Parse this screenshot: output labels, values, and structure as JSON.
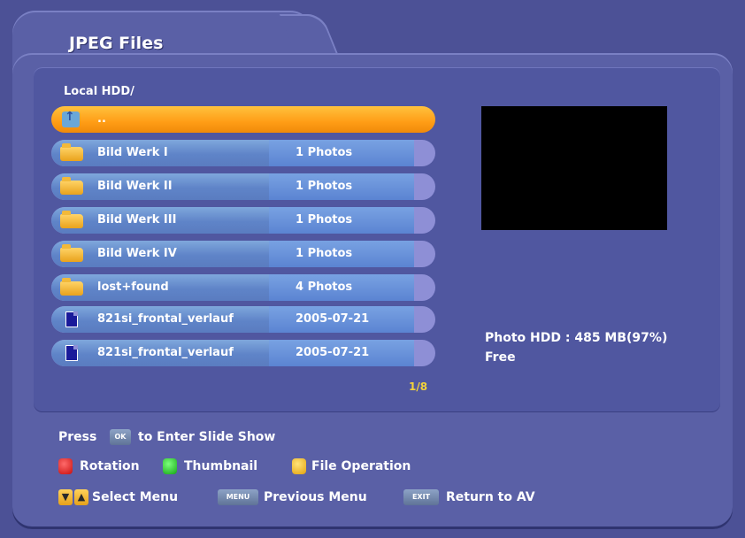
{
  "window": {
    "title": "JPEG Files"
  },
  "browser": {
    "path": "Local HDD/",
    "items": [
      {
        "name": "..",
        "info": "",
        "type": "up"
      },
      {
        "name": "Bild Werk I",
        "info": "1 Photos",
        "type": "folder"
      },
      {
        "name": "Bild Werk II",
        "info": "1 Photos",
        "type": "folder"
      },
      {
        "name": "Bild Werk III",
        "info": "1 Photos",
        "type": "folder"
      },
      {
        "name": "Bild Werk IV",
        "info": "1 Photos",
        "type": "folder"
      },
      {
        "name": "lost+found",
        "info": "4 Photos",
        "type": "folder"
      },
      {
        "name": "821si_frontal_verlauf",
        "info": "2005-07-21",
        "type": "file"
      },
      {
        "name": "821si_frontal_verlauf",
        "info": "2005-07-21",
        "type": "file"
      }
    ],
    "pager": "1/8"
  },
  "hdd": {
    "line1": "Photo HDD : 485 MB(97%)",
    "line2": "Free"
  },
  "footer": {
    "press": "Press",
    "ok_key": "OK",
    "enter_slideshow": "to Enter Slide Show",
    "rotation": "Rotation",
    "thumbnail": "Thumbnail",
    "file_operation": "File Operation",
    "select_menu": "Select Menu",
    "menu_key": "MENU",
    "previous_menu": "Previous Menu",
    "exit_key": "EXIT",
    "return_av": "Return to AV"
  },
  "colors": {
    "background": "#4c5196",
    "selected_row": "#ff9d16",
    "row": "#6a90d2",
    "pager": "#f4d23a"
  }
}
